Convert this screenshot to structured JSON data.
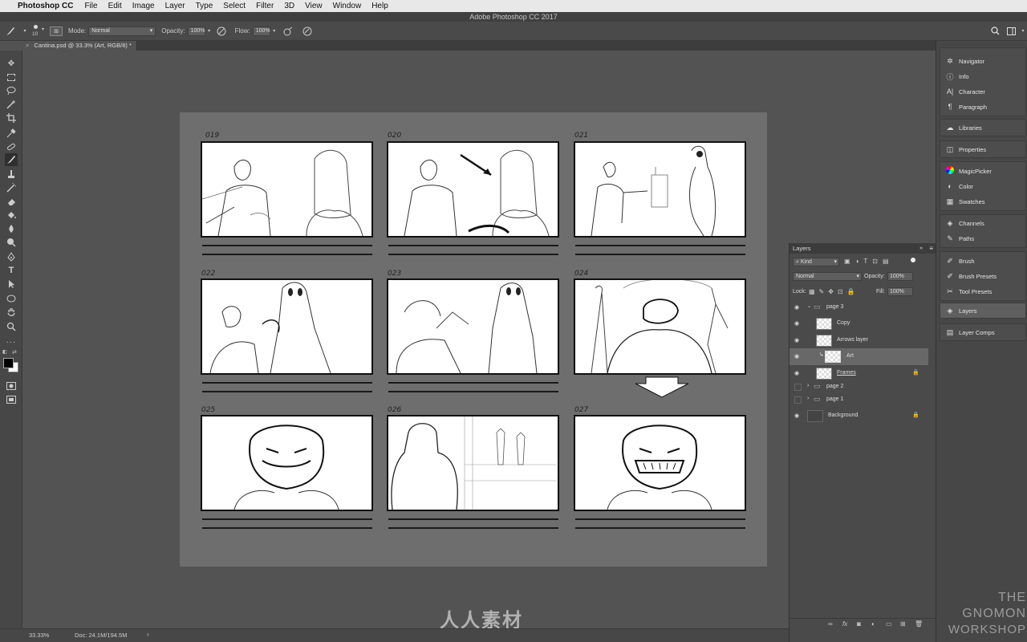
{
  "menubar": {
    "apple": "",
    "app": "Photoshop CC",
    "items": [
      "File",
      "Edit",
      "Image",
      "Layer",
      "Type",
      "Select",
      "Filter",
      "3D",
      "View",
      "Window",
      "Help"
    ]
  },
  "window_title": "Adobe Photoshop CC 2017",
  "options": {
    "brush_size": "10",
    "mode_label": "Mode:",
    "mode_value": "Normal",
    "opacity_label": "Opacity:",
    "opacity_value": "100%",
    "flow_label": "Flow:",
    "flow_value": "100%"
  },
  "document_tab": "Cantina.psd @ 33.3% (Art, RGB/8) *",
  "panels": [
    {
      "num": "019"
    },
    {
      "num": "020"
    },
    {
      "num": "021"
    },
    {
      "num": "022"
    },
    {
      "num": "023"
    },
    {
      "num": "024"
    },
    {
      "num": "025"
    },
    {
      "num": "026"
    },
    {
      "num": "027"
    }
  ],
  "status": {
    "zoom": "33.33%",
    "doc": "Doc: 24.1M/194.5M"
  },
  "layers_panel": {
    "title": "Layers",
    "kind": "Kind",
    "blend": "Normal",
    "opacity_label": "Opacity:",
    "opacity_value": "100%",
    "lock_label": "Lock:",
    "fill_label": "Fill:",
    "fill_value": "100%",
    "layers": [
      "page 3",
      "Copy",
      "Arrows layer",
      "Art",
      "Frames",
      "page 2",
      "page 1",
      "Background"
    ]
  },
  "dock": {
    "group1": [
      "Navigator",
      "Info",
      "Character",
      "Paragraph"
    ],
    "group2": [
      "Libraries"
    ],
    "group3": [
      "Properties"
    ],
    "group4": [
      "MagicPicker",
      "Color",
      "Swatches"
    ],
    "group5": [
      "Channels",
      "Paths"
    ],
    "group6": [
      "Brush",
      "Brush Presets",
      "Tool Presets"
    ],
    "group7": [
      "Layers"
    ],
    "group8": [
      "Layer Comps"
    ]
  },
  "watermarks": {
    "brand1": "人人素材",
    "gnomon1": "THE GNOMON",
    "gnomon2": "WORKSHOP"
  }
}
